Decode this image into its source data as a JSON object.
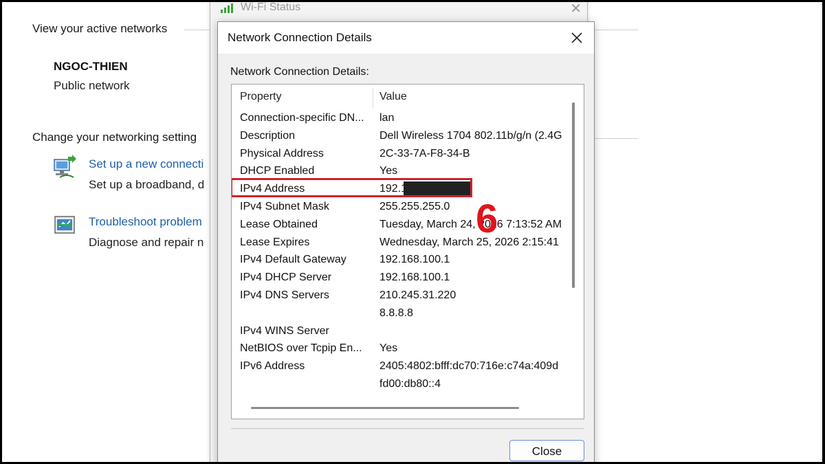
{
  "background": {
    "active_networks_heading": "View your active networks",
    "network_name": "NGOC-THIEN",
    "network_type": "Public network",
    "change_settings_heading": "Change your networking setting",
    "setup_link": "Set up a new connecti",
    "setup_desc": "Set up a broadband, d",
    "troubleshoot_link": "Troubleshoot problem",
    "troubleshoot_desc": "Diagnose and repair n"
  },
  "wifi_window": {
    "title": "Wi-Fi Status"
  },
  "dialog": {
    "title": "Network Connection Details",
    "group_label": "Network Connection Details:",
    "columns": {
      "property": "Property",
      "value": "Value"
    },
    "rows": [
      {
        "property": "Connection-specific DN...",
        "value": "lan"
      },
      {
        "property": "Description",
        "value": "Dell Wireless 1704 802.11b/g/n (2.4G"
      },
      {
        "property": "Physical Address",
        "value": "2C-33-7A-F8-34-B"
      },
      {
        "property": "DHCP Enabled",
        "value": "Yes"
      },
      {
        "property": "IPv4 Address",
        "value": "192.1"
      },
      {
        "property": "IPv4 Subnet Mask",
        "value": "255.255.255.0"
      },
      {
        "property": "Lease Obtained",
        "value": "Tuesday, March 24, 2026 7:13:52 AM"
      },
      {
        "property": "Lease Expires",
        "value": "Wednesday, March 25, 2026 2:15:41"
      },
      {
        "property": "IPv4 Default Gateway",
        "value": "192.168.100.1"
      },
      {
        "property": "IPv4 DHCP Server",
        "value": "192.168.100.1"
      },
      {
        "property": "IPv4 DNS Servers",
        "value": "210.245.31.220"
      },
      {
        "property": "",
        "value": "8.8.8.8"
      },
      {
        "property": "IPv4 WINS Server",
        "value": ""
      },
      {
        "property": "NetBIOS over Tcpip En...",
        "value": "Yes"
      },
      {
        "property": "IPv6 Address",
        "value": "2405:4802:bfff:dc70:716e:c74a:409d"
      },
      {
        "property": "",
        "value": "fd00:db80::4"
      }
    ],
    "close_label": "Close"
  },
  "annotation": {
    "step_number": "6",
    "color": "#d0222b"
  }
}
